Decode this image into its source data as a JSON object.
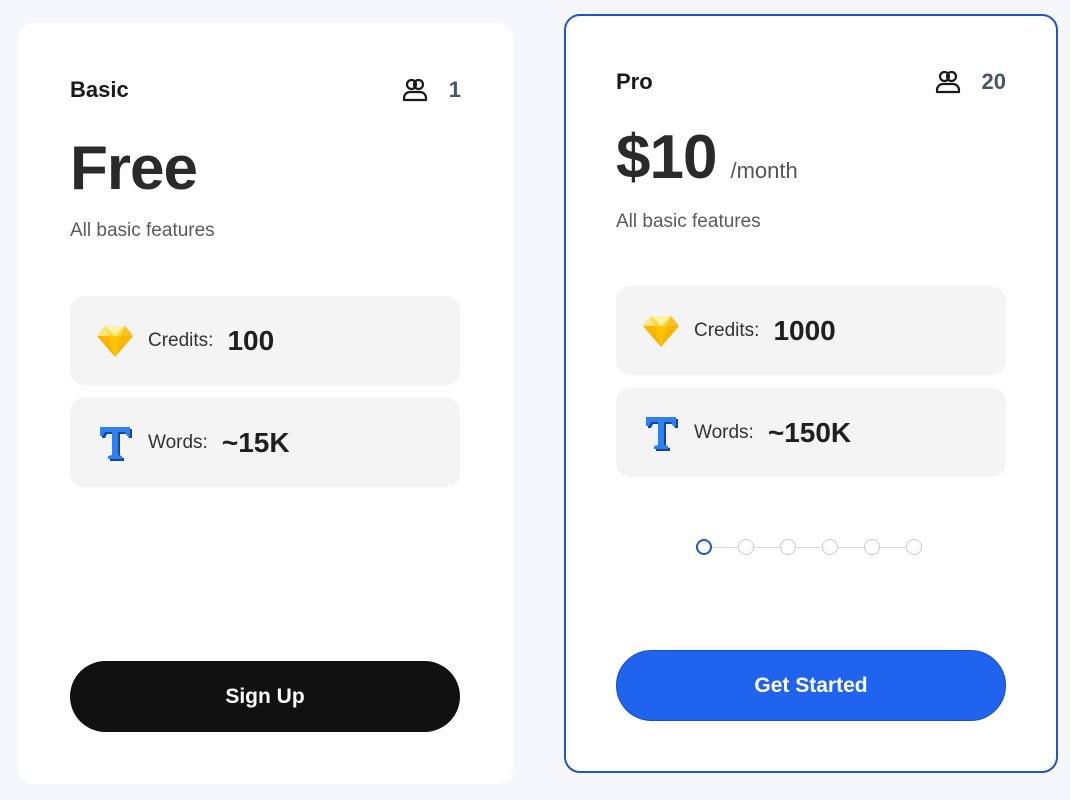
{
  "plans": [
    {
      "name": "Basic",
      "seat_icon": "users-icon",
      "seats": "1",
      "price": "Free",
      "period": "",
      "description": "All basic features",
      "features": [
        {
          "icon": "diamond-icon",
          "label": "Credits:",
          "value": "100"
        },
        {
          "icon": "text-t-icon",
          "label": "Words:",
          "value": "~15K"
        }
      ],
      "cta": "Sign Up"
    },
    {
      "name": "Pro",
      "seat_icon": "users-icon",
      "seats": "20",
      "price": "$10",
      "period": "/month",
      "description": "All basic features",
      "features": [
        {
          "icon": "diamond-icon",
          "label": "Credits:",
          "value": "1000"
        },
        {
          "icon": "text-t-icon",
          "label": "Words:",
          "value": "~150K"
        }
      ],
      "stepper": {
        "steps": 6,
        "selected_index": 0
      },
      "cta": "Get Started"
    }
  ],
  "colors": {
    "accent": "#1f63ee",
    "selected_border": "#1f55c4",
    "primary_dark_button": "#111111"
  }
}
